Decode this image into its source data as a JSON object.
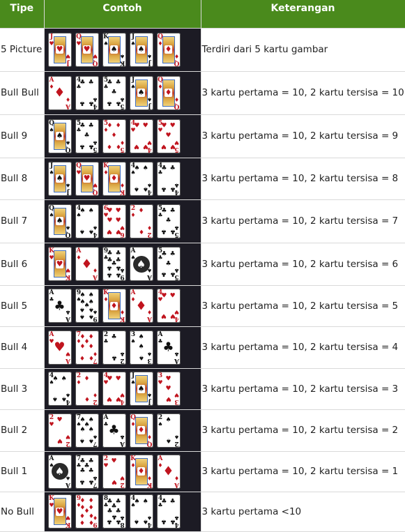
{
  "headers": {
    "tipe": "Tipe",
    "contoh": "Contoh",
    "keterangan": "Keterangan"
  },
  "colors": {
    "header_bg": "#4a8a1c",
    "header_text": "#ffffff",
    "card_cell_bg": "#1c1b24",
    "red_suit": "#c0141e",
    "black_suit": "#111111"
  },
  "rows": [
    {
      "tipe": "5 Picture",
      "keterangan": "Terdiri dari 5 kartu gambar",
      "cards": [
        {
          "rank": "J",
          "suit": "♥"
        },
        {
          "rank": "Q",
          "suit": "♥"
        },
        {
          "rank": "K",
          "suit": "♠"
        },
        {
          "rank": "J",
          "suit": "♠"
        },
        {
          "rank": "Q",
          "suit": "♦"
        }
      ]
    },
    {
      "tipe": "Bull Bull",
      "keterangan": "3 kartu pertama = 10, 2 kartu tersisa = 10",
      "cards": [
        {
          "rank": "A",
          "suit": "♦"
        },
        {
          "rank": "4",
          "suit": "♣"
        },
        {
          "rank": "5",
          "suit": "♣"
        },
        {
          "rank": "J",
          "suit": "♠"
        },
        {
          "rank": "Q",
          "suit": "♦"
        }
      ]
    },
    {
      "tipe": "Bull 9",
      "keterangan": "3 kartu pertama = 10, 2 kartu tersisa = 9",
      "cards": [
        {
          "rank": "Q",
          "suit": "♠"
        },
        {
          "rank": "5",
          "suit": "♣"
        },
        {
          "rank": "5",
          "suit": "♦"
        },
        {
          "rank": "4",
          "suit": "♥"
        },
        {
          "rank": "5",
          "suit": "♥"
        }
      ]
    },
    {
      "tipe": "Bull 8",
      "keterangan": "3 kartu pertama = 10, 2 kartu tersisa = 8",
      "cards": [
        {
          "rank": "J",
          "suit": "♠"
        },
        {
          "rank": "Q",
          "suit": "♥"
        },
        {
          "rank": "K",
          "suit": "♦"
        },
        {
          "rank": "4",
          "suit": "♠"
        },
        {
          "rank": "4",
          "suit": "♣"
        }
      ]
    },
    {
      "tipe": "Bull 7",
      "keterangan": "3 kartu pertama = 10, 2 kartu tersisa = 7",
      "cards": [
        {
          "rank": "Q",
          "suit": "♠"
        },
        {
          "rank": "4",
          "suit": "♠"
        },
        {
          "rank": "6",
          "suit": "♥"
        },
        {
          "rank": "2",
          "suit": "♦"
        },
        {
          "rank": "5",
          "suit": "♣"
        }
      ]
    },
    {
      "tipe": "Bull 6",
      "keterangan": "3 kartu pertama = 10, 2 kartu tersisa = 6",
      "cards": [
        {
          "rank": "K",
          "suit": "♥"
        },
        {
          "rank": "A",
          "suit": "♦"
        },
        {
          "rank": "9",
          "suit": "♣"
        },
        {
          "rank": "A",
          "suit": "♠"
        },
        {
          "rank": "5",
          "suit": "♣"
        }
      ]
    },
    {
      "tipe": "Bull 5",
      "keterangan": "3 kartu pertama = 10, 2 kartu tersisa = 5",
      "cards": [
        {
          "rank": "A",
          "suit": "♣"
        },
        {
          "rank": "9",
          "suit": "♠"
        },
        {
          "rank": "K",
          "suit": "♦"
        },
        {
          "rank": "A",
          "suit": "♦"
        },
        {
          "rank": "4",
          "suit": "♥"
        }
      ]
    },
    {
      "tipe": "Bull 4",
      "keterangan": "3 kartu pertama = 10, 2 kartu tersisa = 4",
      "cards": [
        {
          "rank": "A",
          "suit": "♥"
        },
        {
          "rank": "7",
          "suit": "♦"
        },
        {
          "rank": "2",
          "suit": "♣"
        },
        {
          "rank": "3",
          "suit": "♠"
        },
        {
          "rank": "A",
          "suit": "♣"
        }
      ]
    },
    {
      "tipe": "Bull 3",
      "keterangan": "3 kartu pertama = 10, 2 kartu tersisa = 3",
      "cards": [
        {
          "rank": "4",
          "suit": "♠"
        },
        {
          "rank": "2",
          "suit": "♦"
        },
        {
          "rank": "4",
          "suit": "♥"
        },
        {
          "rank": "J",
          "suit": "♠"
        },
        {
          "rank": "3",
          "suit": "♥"
        }
      ]
    },
    {
      "tipe": "Bull 2",
      "keterangan": "3 kartu pertama = 10, 2 kartu tersisa = 2",
      "cards": [
        {
          "rank": "2",
          "suit": "♥"
        },
        {
          "rank": "7",
          "suit": "♠"
        },
        {
          "rank": "A",
          "suit": "♣"
        },
        {
          "rank": "Q",
          "suit": "♦"
        },
        {
          "rank": "2",
          "suit": "♠"
        }
      ]
    },
    {
      "tipe": "Bull 1",
      "keterangan": "3 kartu pertama = 10, 2 kartu tersisa = 1",
      "cards": [
        {
          "rank": "A",
          "suit": "♠"
        },
        {
          "rank": "7",
          "suit": "♣"
        },
        {
          "rank": "2",
          "suit": "♥"
        },
        {
          "rank": "K",
          "suit": "♦"
        },
        {
          "rank": "A",
          "suit": "♦"
        }
      ]
    },
    {
      "tipe": "No Bull",
      "keterangan": "3 kartu pertama <10",
      "cards": [
        {
          "rank": "K",
          "suit": "♥"
        },
        {
          "rank": "9",
          "suit": "♦"
        },
        {
          "rank": "8",
          "suit": "♣"
        },
        {
          "rank": "4",
          "suit": "♠"
        },
        {
          "rank": "4",
          "suit": "♣"
        }
      ]
    }
  ]
}
